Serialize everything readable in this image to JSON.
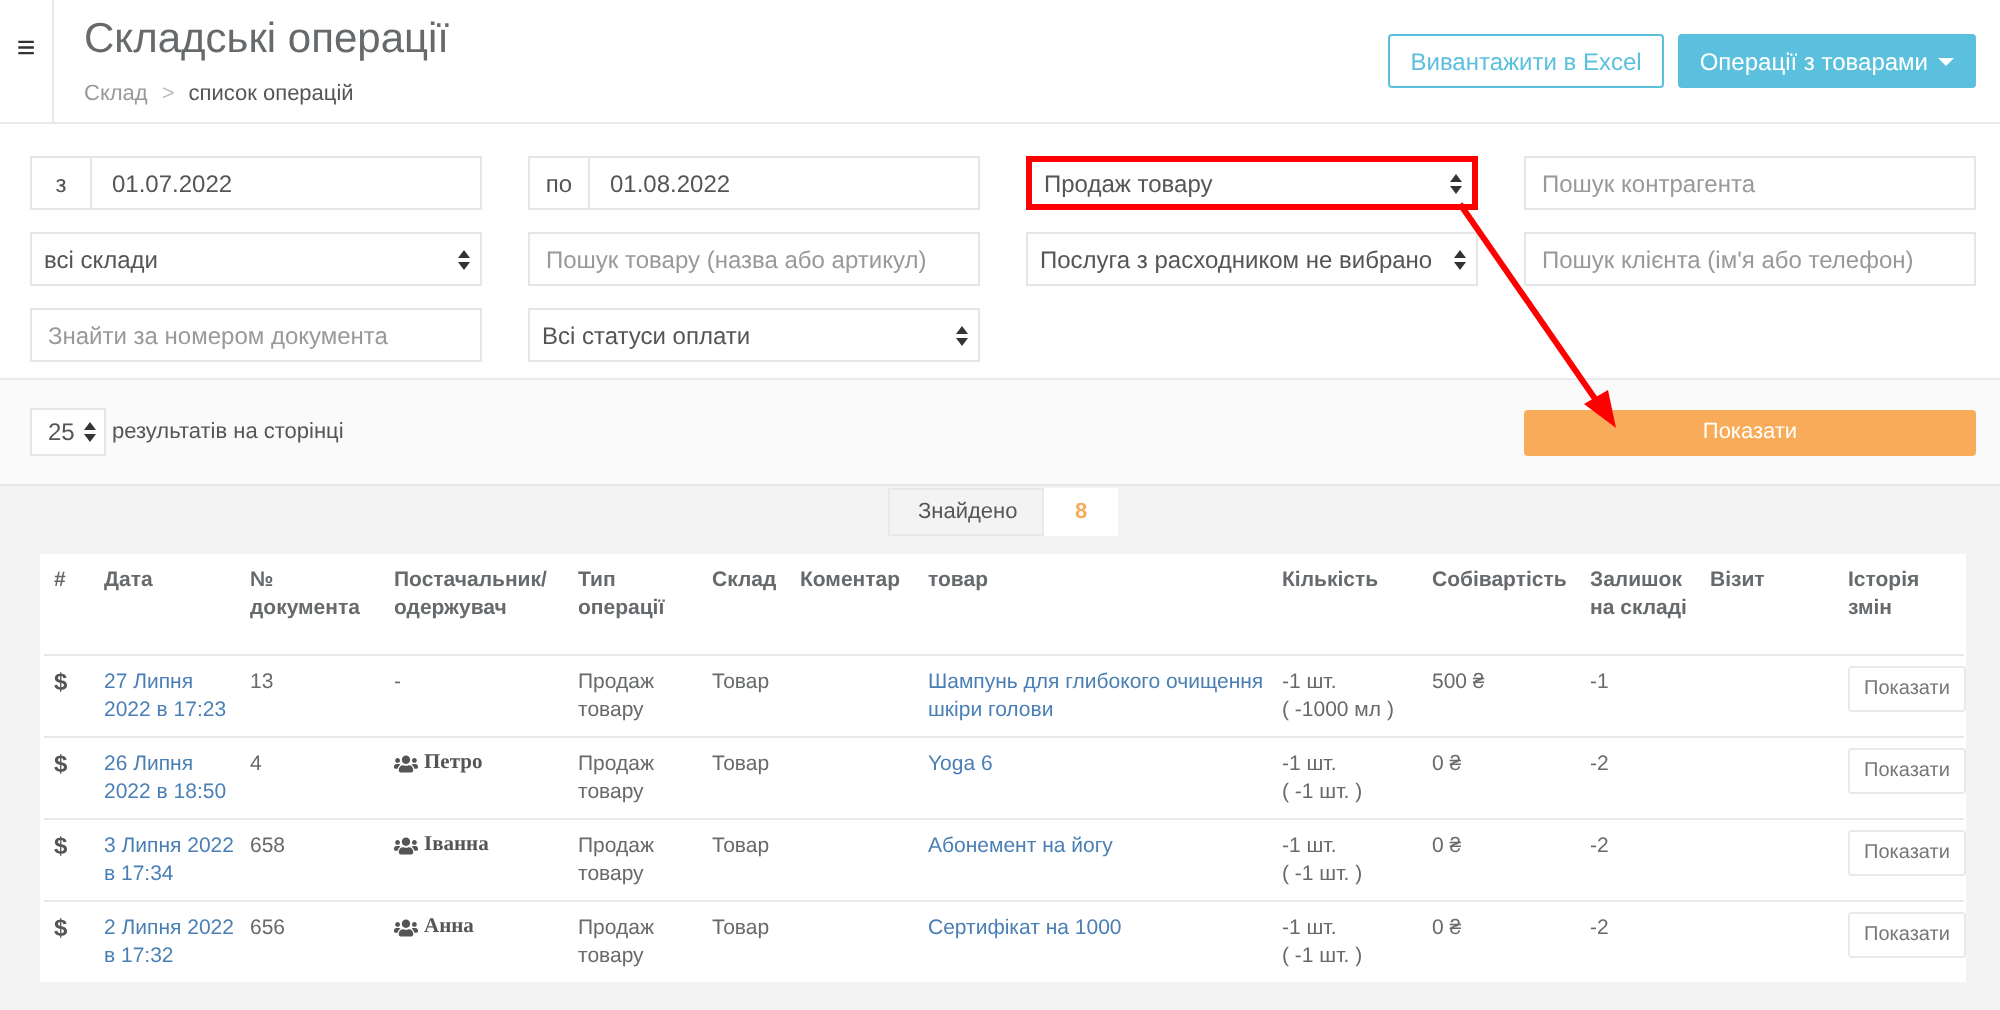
{
  "header": {
    "menu_icon": "≡",
    "title": "Складські операції",
    "breadcrumb": [
      {
        "label": "Склад",
        "current": false
      },
      {
        "label": "список операцій",
        "current": true
      }
    ],
    "breadcrumb_separator": ">",
    "buttons": [
      {
        "label": "Вивантажити в Excel",
        "kind": "outline"
      },
      {
        "label": "Операції з товарами",
        "kind": "dropdown"
      }
    ]
  },
  "filter_columns": [
    [
      {
        "kind": "date",
        "prefix": "з",
        "value": "01.07.2022"
      },
      {
        "kind": "select",
        "value": "всі склади",
        "highlighted": false
      },
      {
        "kind": "input",
        "placeholder": "Знайти за номером документа"
      }
    ],
    [
      {
        "kind": "date",
        "prefix": "по",
        "value": "01.08.2022"
      },
      {
        "kind": "input",
        "placeholder": "Пошук товару (назва або артикул)"
      },
      {
        "kind": "select",
        "value": "Всі статуси оплати",
        "highlighted": false
      }
    ],
    [
      {
        "kind": "select",
        "value": "Продаж товару",
        "highlighted": true
      },
      {
        "kind": "select",
        "value": "Послуга з расходником не вибрано",
        "highlighted": false
      }
    ],
    [
      {
        "kind": "input",
        "placeholder": "Пошук контрагента"
      },
      {
        "kind": "input",
        "placeholder": "Пошук клієнта (ім'я або телефон)"
      }
    ]
  ],
  "per_page": {
    "value": "25",
    "label": "результатів на сторінці"
  },
  "show_button": "Показати",
  "found": {
    "label": "Знайдено",
    "count": "8"
  },
  "table": {
    "columns": [
      "#",
      "Дата",
      "№ документа",
      "Постачальник/ одержувач",
      "Тип операції",
      "Склад",
      "Коментар",
      "товар",
      "Кількість",
      "Собівартість",
      "Залишок на складі",
      "Візит",
      "Історія змін"
    ],
    "rows": [
      {
        "mark": "$",
        "date": "27 Липня 2022 в 17:23",
        "document": "13",
        "counterparty": {
          "text": "-",
          "group": false
        },
        "type": "Продаж товару",
        "warehouse": "Товар",
        "product": "Шампунь для глибокого очищення шкіри голови",
        "quantity": [
          "-1 шт.",
          "( -1000 мл )"
        ],
        "cost": "500 ₴",
        "stock": "-1",
        "history": "Показати"
      },
      {
        "mark": "$",
        "date": "26 Липня 2022 в 18:50",
        "document": "4",
        "counterparty": {
          "text": "Петро",
          "group": true
        },
        "type": "Продаж товару",
        "warehouse": "Товар",
        "product": "Yoga 6",
        "quantity": [
          "-1 шт.",
          "( -1 шт. )"
        ],
        "cost": "0 ₴",
        "stock": "-2",
        "history": "Показати"
      },
      {
        "mark": "$",
        "date": "3 Липня 2022 в 17:34",
        "document": "658",
        "counterparty": {
          "text": "Іванна",
          "group": true
        },
        "type": "Продаж товару",
        "warehouse": "Товар",
        "product": "Абонемент на йогу",
        "quantity": [
          "-1 шт.",
          "( -1 шт. )"
        ],
        "cost": "0 ₴",
        "stock": "-2",
        "history": "Показати"
      },
      {
        "mark": "$",
        "date": "2 Липня 2022 в 17:32",
        "document": "656",
        "counterparty": {
          "text": "Анна",
          "group": true
        },
        "type": "Продаж товару",
        "warehouse": "Товар",
        "product": "Сертифікат на 1000",
        "quantity": [
          "-1 шт.",
          "( -1 шт. )"
        ],
        "cost": "0 ₴",
        "stock": "-2",
        "history": "Показати"
      }
    ]
  }
}
